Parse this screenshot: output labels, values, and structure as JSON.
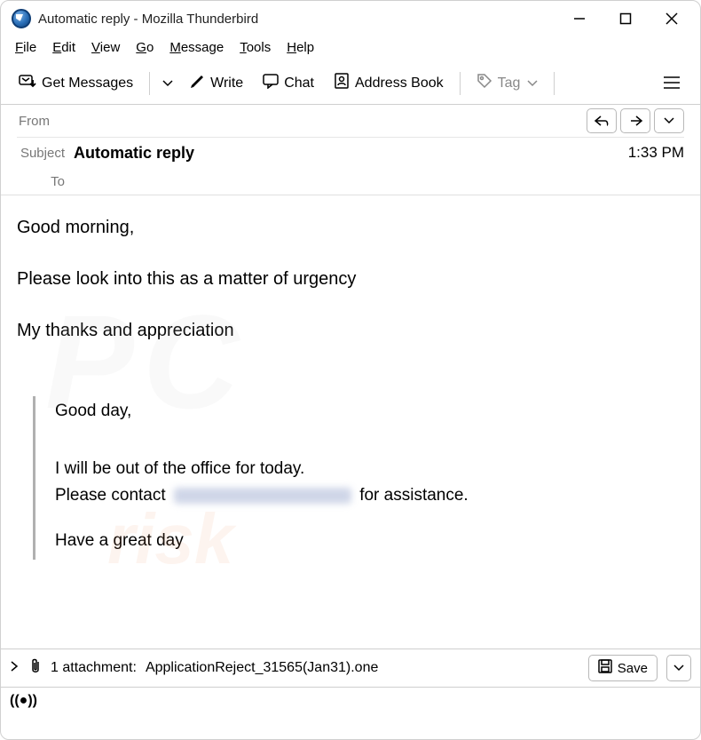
{
  "window": {
    "title": "Automatic reply - Mozilla Thunderbird"
  },
  "menubar": {
    "file": "File",
    "edit": "Edit",
    "view": "View",
    "go": "Go",
    "message": "Message",
    "tools": "Tools",
    "help": "Help"
  },
  "toolbar": {
    "get_messages": "Get Messages",
    "write": "Write",
    "chat": "Chat",
    "address_book": "Address Book",
    "tag": "Tag"
  },
  "headers": {
    "from_label": "From",
    "from_value": "",
    "subject_label": "Subject",
    "subject_value": "Automatic reply",
    "to_label": "To",
    "to_value": "",
    "time": "1:33 PM"
  },
  "body": {
    "line1": "Good morning,",
    "line2": "Please look into this as a matter of urgency",
    "line3": "My thanks and appreciation",
    "quoted": {
      "l1": "Good day,",
      "l2": "I will be out of the office for today.",
      "l3a": "Please contact",
      "l3b": "for assistance.",
      "l4": "Have a great day"
    }
  },
  "attachment": {
    "count_text": "1 attachment:",
    "filename": "ApplicationReject_31565(Jan31).one",
    "save_label": "Save"
  }
}
